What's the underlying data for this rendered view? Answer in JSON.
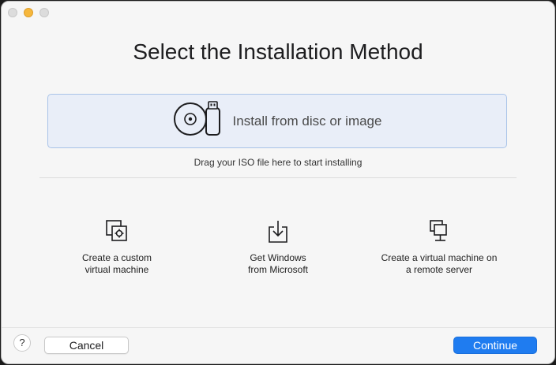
{
  "window": {
    "title": "Select the Installation Method"
  },
  "dropzone": {
    "label": "Install from disc or image",
    "icon": "disc-usb-icon",
    "hint": "Drag your ISO file here to start installing"
  },
  "options": [
    {
      "label_line1": "Create a custom",
      "label_line2": "virtual machine",
      "icon": "custom-vm-icon"
    },
    {
      "label_line1": "Get Windows",
      "label_line2": "from Microsoft",
      "icon": "download-icon"
    },
    {
      "label_line1": "Create a virtual machine on",
      "label_line2": "a remote server",
      "icon": "remote-server-icon"
    }
  ],
  "footer": {
    "help_label": "?",
    "cancel_label": "Cancel",
    "continue_label": "Continue"
  },
  "colors": {
    "accent": "#1f7cf0",
    "dropzone_bg": "#e9eef8",
    "dropzone_border": "#a9c3e8",
    "minimize_light": "#f6b73c"
  }
}
